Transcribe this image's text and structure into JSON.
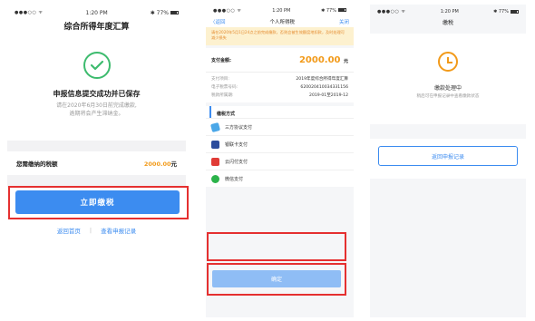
{
  "screen1": {
    "status": {
      "signal": "●●●○○ ᯤ",
      "time": "1:20 PM",
      "battery": "✱ 77%"
    },
    "title": "综合所得年度汇算",
    "success_title": "申报信息提交成功并已保存",
    "success_desc_1": "请在2020年6月30日前完成缴款,",
    "success_desc_2": "逾期将会产生滞纳金。",
    "amount_label": "您需缴纳的税额",
    "amount_value": "2000.00",
    "amount_unit": "元",
    "pay_button": "立即缴税",
    "link_home": "返回首页",
    "link_separator": "|",
    "link_records": "查看申报记录"
  },
  "screen2": {
    "status": {
      "signal": "●●●○○ ᯤ",
      "time": "1:20 PM",
      "battery": "✱ 77%"
    },
    "back": "〈返回",
    "title": "个人所得税",
    "close": "关闭",
    "warning": "请在2020年5月1日24点之前完成缴款，否则会被生效额度地扣款，及时处理可减少损失",
    "amount_label": "支付金额:",
    "amount_value": "2000.00",
    "amount_unit": "元",
    "details": [
      {
        "label": "支付项目:",
        "value": "2019年度综合所得年度汇算"
      },
      {
        "label": "电子税票号码:",
        "value": "620020410034331156"
      },
      {
        "label": "税款所属期:",
        "value": "2019-01至2019-12"
      }
    ],
    "methods_header": "缴税方式",
    "methods": [
      {
        "label": "三方协议支付",
        "icon": "contract-icon"
      },
      {
        "label": "银联卡支付",
        "icon": "unionpay-icon"
      },
      {
        "label": "云闪付支付",
        "icon": "cloud-pay-icon"
      },
      {
        "label": "微信支付",
        "icon": "wechat-icon"
      }
    ],
    "confirm": "确定",
    "highlight_color": "#e53030"
  },
  "screen3": {
    "status": {
      "signal": "●●●○○ ᯤ",
      "time": "1:20 PM",
      "battery": "✱ 77%"
    },
    "title": "缴税",
    "status_text": "缴款处理中",
    "status_desc": "稍后可在申报记录中查看缴款状态",
    "back_button": "返回申报记录"
  },
  "colors": {
    "accent": "#3c8cf0",
    "success": "#3dbb6e",
    "amount": "#f29a1a",
    "highlight": "#e53030"
  }
}
